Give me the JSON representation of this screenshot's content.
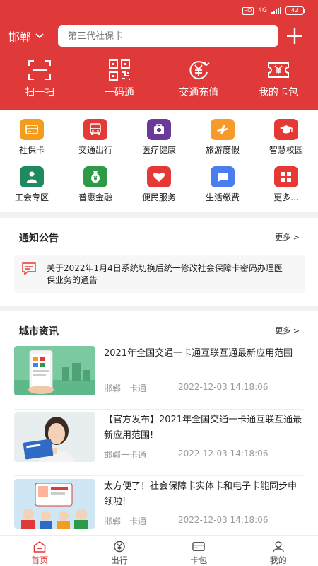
{
  "status": {
    "hd": "HD",
    "network": "4G",
    "battery": "42"
  },
  "header": {
    "city": "邯郸",
    "search_placeholder": "第三代社保卡"
  },
  "quick_actions": [
    {
      "label": "扫一扫",
      "icon": "scan-icon"
    },
    {
      "label": "一码通",
      "icon": "qrcode-icon"
    },
    {
      "label": "交通充值",
      "icon": "yen-recharge-icon"
    },
    {
      "label": "我的卡包",
      "icon": "card-wallet-icon"
    }
  ],
  "services": [
    {
      "label": "社保卡",
      "icon": "card-icon",
      "color": "#f39c1d"
    },
    {
      "label": "交通出行",
      "icon": "bus-icon",
      "color": "#e53935"
    },
    {
      "label": "医疗健康",
      "icon": "medical-kit-icon",
      "color": "#6a3a9a"
    },
    {
      "label": "旅游度假",
      "icon": "airplane-icon",
      "color": "#f59a2b"
    },
    {
      "label": "智慧校园",
      "icon": "graduation-cap-icon",
      "color": "#e53935"
    },
    {
      "label": "工会专区",
      "icon": "union-member-icon",
      "color": "#1f8a5e"
    },
    {
      "label": "普惠金融",
      "icon": "money-bag-icon",
      "color": "#2e9a47"
    },
    {
      "label": "便民服务",
      "icon": "heart-icon",
      "color": "#e53935"
    },
    {
      "label": "生活缴费",
      "icon": "chat-bubble-icon",
      "color": "#4a7df0"
    },
    {
      "label": "更多...",
      "icon": "grid-more-icon",
      "color": "#e53935"
    }
  ],
  "notice": {
    "title": "通知公告",
    "more": "更多 >",
    "text": "关于2022年1月4日系统切换后统一修改社会保障卡密码办理医保业务的通告"
  },
  "news": {
    "title": "城市资讯",
    "more": "更多 >",
    "items": [
      {
        "title": "2021年全国交通一卡通互联互通最新应用范围",
        "source": "邯郸一卡通",
        "time": "2022-12-03 14:18:06"
      },
      {
        "title": "【官方发布】2021年全国交通一卡通互联互通最新应用范围!",
        "source": "邯郸一卡通",
        "time": "2022-12-03 14:18:06"
      },
      {
        "title": "太方便了！社会保障卡实体卡和电子卡能同步申领啦!",
        "source": "邯郸一卡通",
        "time": "2022-12-03 14:18:06"
      }
    ]
  },
  "tabs": [
    {
      "label": "首页",
      "active": true
    },
    {
      "label": "出行",
      "active": false
    },
    {
      "label": "卡包",
      "active": false
    },
    {
      "label": "我的",
      "active": false
    }
  ],
  "colors": {
    "brand_red": "#e0393a"
  }
}
